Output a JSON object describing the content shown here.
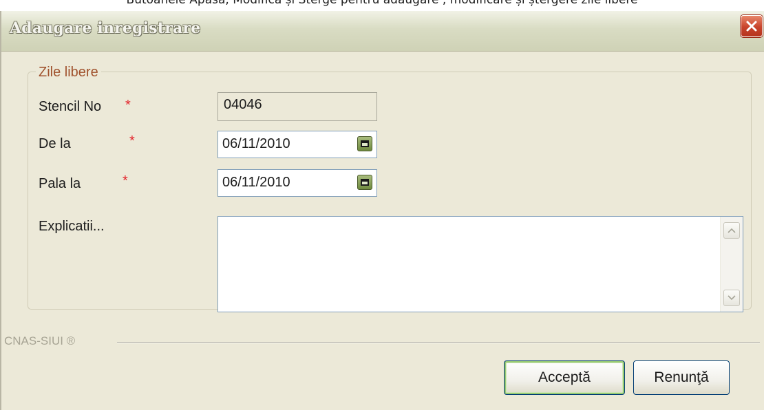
{
  "top_caption": "Butoanele  Apasa, Modifica și Sterge pentru adaugare , modificare și ștergere zile libere",
  "window": {
    "title": "Adaugare inregistrare",
    "close_icon": "close-icon"
  },
  "group": {
    "legend": "Zile libere"
  },
  "fields": {
    "stencil_label": "Stencil No",
    "stencil_value": "04046",
    "from_label": "De la",
    "from_value": "06/11/2010",
    "to_label": "Pala la",
    "to_value": "06/11/2010",
    "notes_label": "Explicatii...",
    "notes_value": "",
    "required_mark": "*"
  },
  "footer": {
    "brand": "CNAS-SIUI ®"
  },
  "buttons": {
    "accept": "Acceptă",
    "cancel": "Renunţă"
  },
  "colors": {
    "legend": "#a0522d",
    "required": "#e3242b",
    "close_button": "#c8432b"
  }
}
